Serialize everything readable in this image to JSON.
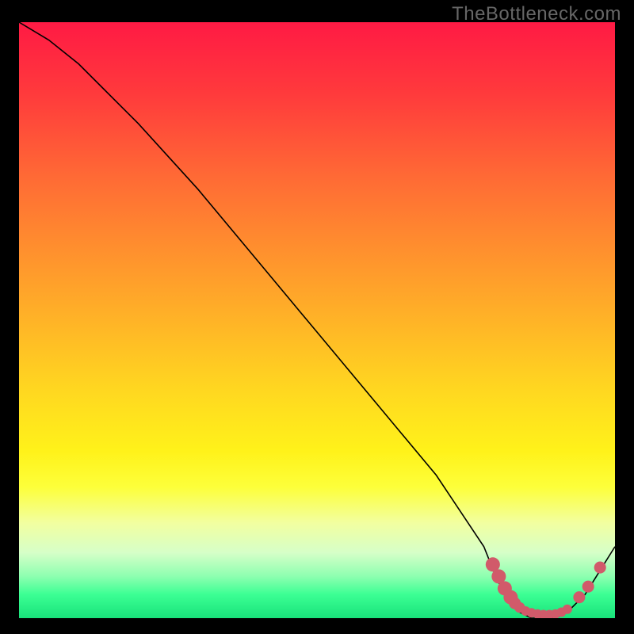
{
  "watermark": "TheBottleneck.com",
  "chart_data": {
    "type": "line",
    "title": "",
    "xlabel": "",
    "ylabel": "",
    "xlim": [
      0,
      100
    ],
    "ylim": [
      0,
      100
    ],
    "series": [
      {
        "name": "curve",
        "x": [
          0,
          5,
          10,
          20,
          30,
          40,
          50,
          60,
          70,
          78,
          80,
          82,
          84,
          86,
          88,
          90,
          92,
          95,
          100
        ],
        "y": [
          100,
          97,
          93,
          83,
          72,
          60,
          48,
          36,
          24,
          12,
          7,
          3,
          1,
          0,
          0,
          0,
          1,
          4,
          12
        ]
      }
    ],
    "markers": [
      {
        "x": 79.5,
        "y": 9.0,
        "r": 1.2
      },
      {
        "x": 80.5,
        "y": 7.0,
        "r": 1.2
      },
      {
        "x": 81.5,
        "y": 5.0,
        "r": 1.2
      },
      {
        "x": 82.5,
        "y": 3.5,
        "r": 1.2
      },
      {
        "x": 83.2,
        "y": 2.5,
        "r": 1.0
      },
      {
        "x": 84.0,
        "y": 1.8,
        "r": 0.9
      },
      {
        "x": 85.0,
        "y": 1.2,
        "r": 0.8
      },
      {
        "x": 86.0,
        "y": 0.9,
        "r": 0.8
      },
      {
        "x": 87.0,
        "y": 0.7,
        "r": 0.8
      },
      {
        "x": 88.0,
        "y": 0.6,
        "r": 0.8
      },
      {
        "x": 89.0,
        "y": 0.6,
        "r": 0.8
      },
      {
        "x": 90.0,
        "y": 0.7,
        "r": 0.8
      },
      {
        "x": 91.0,
        "y": 1.0,
        "r": 0.8
      },
      {
        "x": 92.0,
        "y": 1.5,
        "r": 0.8
      },
      {
        "x": 94.0,
        "y": 3.5,
        "r": 1.0
      },
      {
        "x": 95.5,
        "y": 5.3,
        "r": 1.0
      },
      {
        "x": 97.5,
        "y": 8.5,
        "r": 1.0
      }
    ],
    "colors": {
      "curve_stroke": "#000000",
      "marker_fill": "#d15a6a"
    }
  }
}
